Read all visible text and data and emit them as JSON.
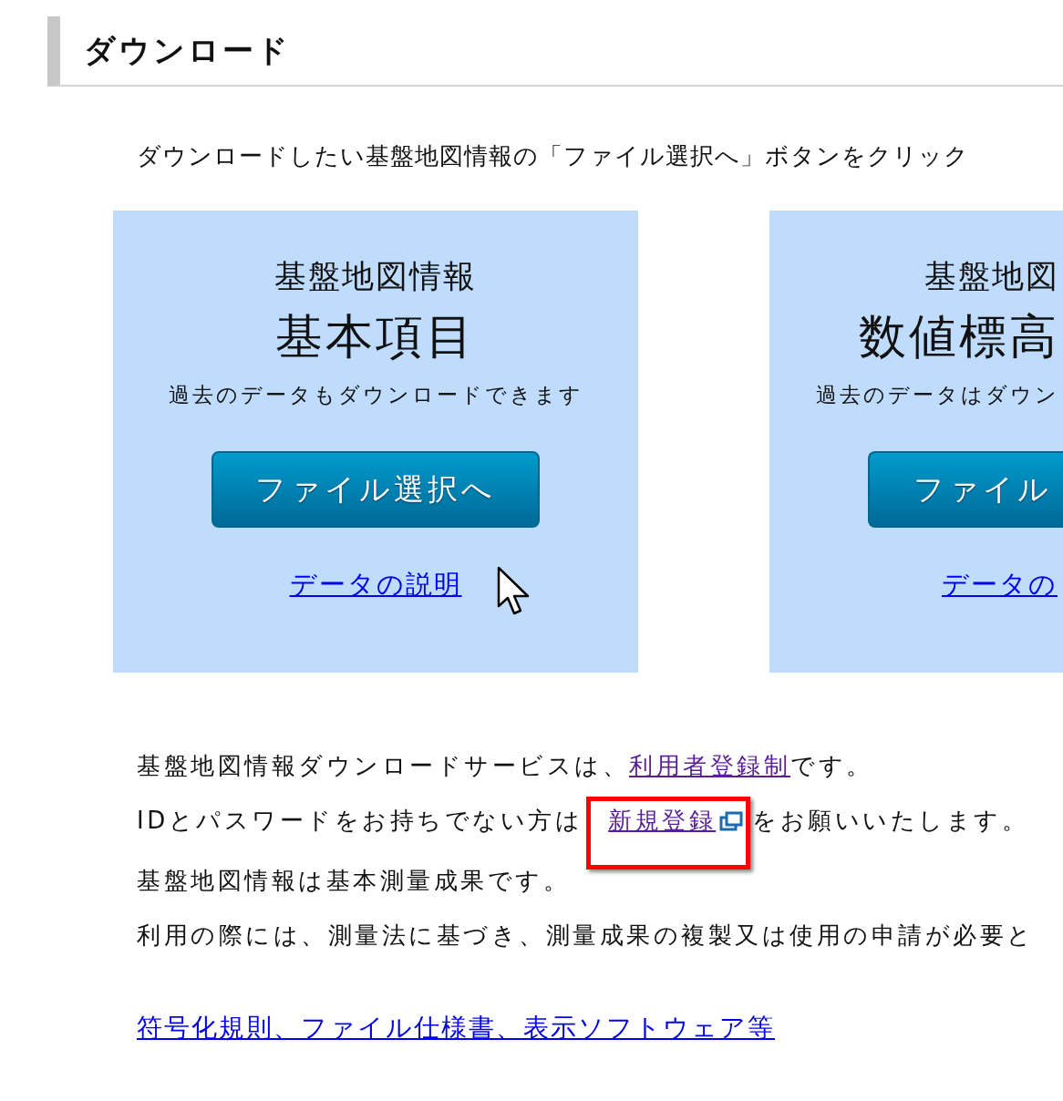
{
  "heading": "ダウンロード",
  "intro": "ダウンロードしたい基盤地図情報の「ファイル選択へ」ボタンをクリック",
  "cards": [
    {
      "category": "基盤地図情報",
      "title": "基本項目",
      "note": "過去のデータもダウンロードできます",
      "button": "ファイル選択へ",
      "link": "データの説明",
      "clipped": false
    },
    {
      "category": "基盤地図",
      "title": "数値標高",
      "note": "過去のデータはダウン",
      "button": "ファイル",
      "link": "データの",
      "clipped": true
    }
  ],
  "notice": [
    {
      "before": "基盤地図情報ダウンロードサービスは、",
      "link": "利用者登録制",
      "after": "です。",
      "visited": true,
      "external": false,
      "highlighted": false
    },
    {
      "before": "IDとパスワードをお持ちでない方は",
      "link": "新規登録",
      "after": "をお願いいたします。",
      "visited": true,
      "external": true,
      "highlighted": true
    }
  ],
  "paragraphs": [
    "基盤地図情報は基本測量成果です。",
    "利用の際には、測量法に基づき、測量成果の複製又は使用の申請が必要と"
  ],
  "footer_link": "符号化規則、ファイル仕様書、表示ソフトウェア等"
}
